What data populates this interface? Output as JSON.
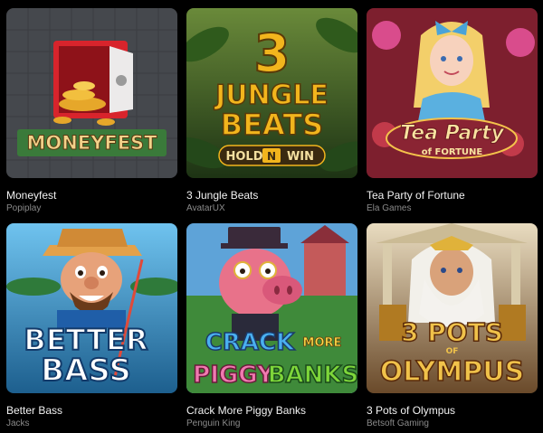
{
  "games": [
    {
      "title": "Moneyfest",
      "provider": "Popiplay",
      "logo": [
        "MONEYFEST"
      ],
      "icon": "red-safe-with-coins-icon",
      "colors": {
        "bg": "#4a4d52",
        "accent": "#d8242c",
        "gold": "#e6a72a"
      }
    },
    {
      "title": "3 Jungle Beats",
      "provider": "AvatarUX",
      "logo": [
        "3",
        "JUNGLE",
        "BEATS",
        "HOLD",
        "N",
        "WIN"
      ],
      "icon": "jungle-leaves-icon",
      "colors": {
        "bg": "#2d4a1f",
        "accent": "#f2b51d",
        "gold": "#ffd44a"
      }
    },
    {
      "title": "Tea Party of Fortune",
      "provider": "Ela Games",
      "logo": [
        "Tea Party",
        "of FORTUNE"
      ],
      "icon": "alice-girl-character-icon",
      "colors": {
        "bg": "#8a2433",
        "accent": "#d94c8c",
        "gold": "#f4c34b"
      }
    },
    {
      "title": "Better Bass",
      "provider": "Jacks",
      "logo": [
        "BETTER",
        "BASS"
      ],
      "icon": "fisherman-character-icon",
      "colors": {
        "bg": "#2f8fc7",
        "accent": "#1f5ea8",
        "gold": "#e3a14a"
      }
    },
    {
      "title": "Crack More Piggy Banks",
      "provider": "Penguin King",
      "logo": [
        "CRACK",
        "MORE",
        "PIGGY",
        "BANKS"
      ],
      "icon": "pig-character-icon",
      "colors": {
        "bg": "#5ea3d8",
        "accent": "#e9558f",
        "gold": "#7ed63a"
      }
    },
    {
      "title": "3 Pots of Olympus",
      "provider": "Betsoft Gaming",
      "logo": [
        "3 POTS",
        "OF",
        "OLYMPUS"
      ],
      "icon": "zeus-character-icon",
      "colors": {
        "bg": "#c9b98f",
        "accent": "#b07a22",
        "gold": "#f0c24a"
      }
    }
  ]
}
